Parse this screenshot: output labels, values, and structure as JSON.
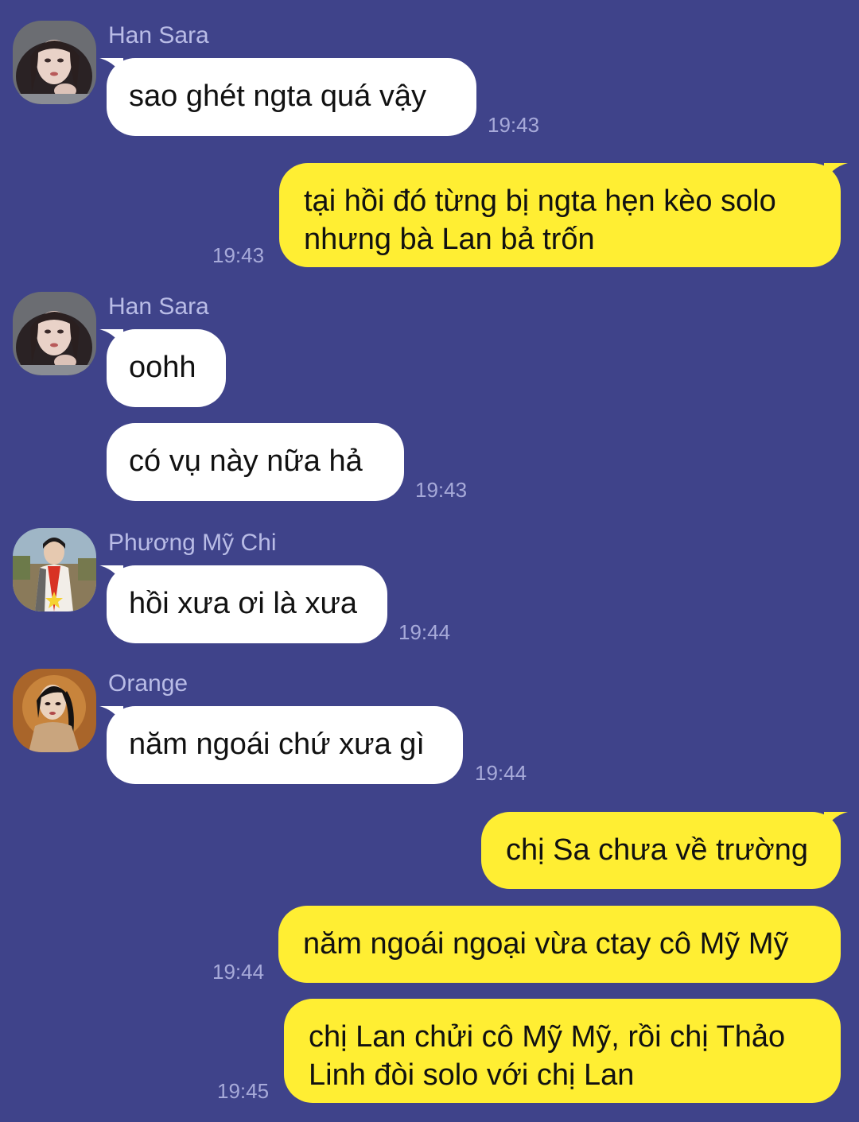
{
  "messages": [
    {
      "sender": "Han Sara",
      "text": "sao ghét ngta quá vậy",
      "time": "19:43",
      "avatar": "han-sara-avatar"
    },
    {
      "sender": "me",
      "lines": [
        "tại hồi đó từng bị ngta hẹn kèo solo",
        "nhưng bà Lan bả trốn"
      ],
      "time": "19:43"
    },
    {
      "sender": "Han Sara",
      "text": "oohh",
      "avatar": "han-sara-avatar"
    },
    {
      "sender": "Han Sara",
      "text": "có vụ này nữa hả",
      "time": "19:43"
    },
    {
      "sender": "Phương Mỹ Chi",
      "text": "hồi xưa ơi là xưa",
      "time": "19:44",
      "avatar": "phuong-my-chi-avatar"
    },
    {
      "sender": "Orange",
      "text": "năm ngoái chứ xưa gì",
      "time": "19:44",
      "avatar": "orange-avatar"
    },
    {
      "sender": "me",
      "text": "chị Sa chưa về trường"
    },
    {
      "sender": "me",
      "text": "năm ngoái ngoại vừa ctay cô Mỹ Mỹ",
      "time": "19:44"
    },
    {
      "sender": "me",
      "lines": [
        "chị Lan chửi cô Mỹ Mỹ, rồi chị Thảo",
        "Linh đòi solo với chị Lan"
      ],
      "time": "19:45"
    }
  ],
  "colors": {
    "background": "#3f438a",
    "incoming_bubble": "#ffffff",
    "outgoing_bubble": "#ffee33",
    "sender_name": "#b9bce6",
    "timestamp": "#a7aad9"
  }
}
